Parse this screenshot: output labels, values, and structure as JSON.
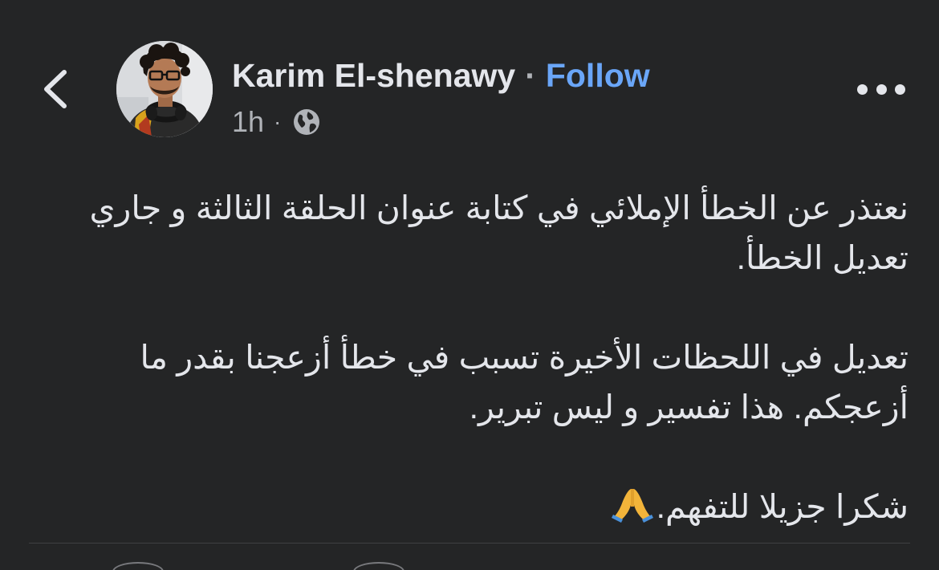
{
  "header": {
    "back_icon": "chevron-left-icon",
    "author_name": "Karim El-shenawy",
    "separator": "·",
    "follow_label": "Follow",
    "time_ago": "1h",
    "meta_separator": "·",
    "audience_icon": "globe-icon",
    "more_icon": "more-horizontal-icon"
  },
  "post": {
    "paragraphs": [
      "نعتذر عن الخطأ الإملائي في كتابة عنوان الحلقة الثالثة و جاري تعديل الخطأ.",
      "تعديل في اللحظات الأخيرة تسبب في خطأ أزعجنا بقدر ما أزعجكم. هذا تفسير و ليس تبرير.",
      "شكرا جزيلا للتفهم."
    ],
    "emoji": "🙏",
    "emoji_name": "folded-hands"
  },
  "colors": {
    "background": "#242526",
    "text": "#e4e6eb",
    "secondary_text": "#b0b3b8",
    "link": "#6aa6f8"
  }
}
